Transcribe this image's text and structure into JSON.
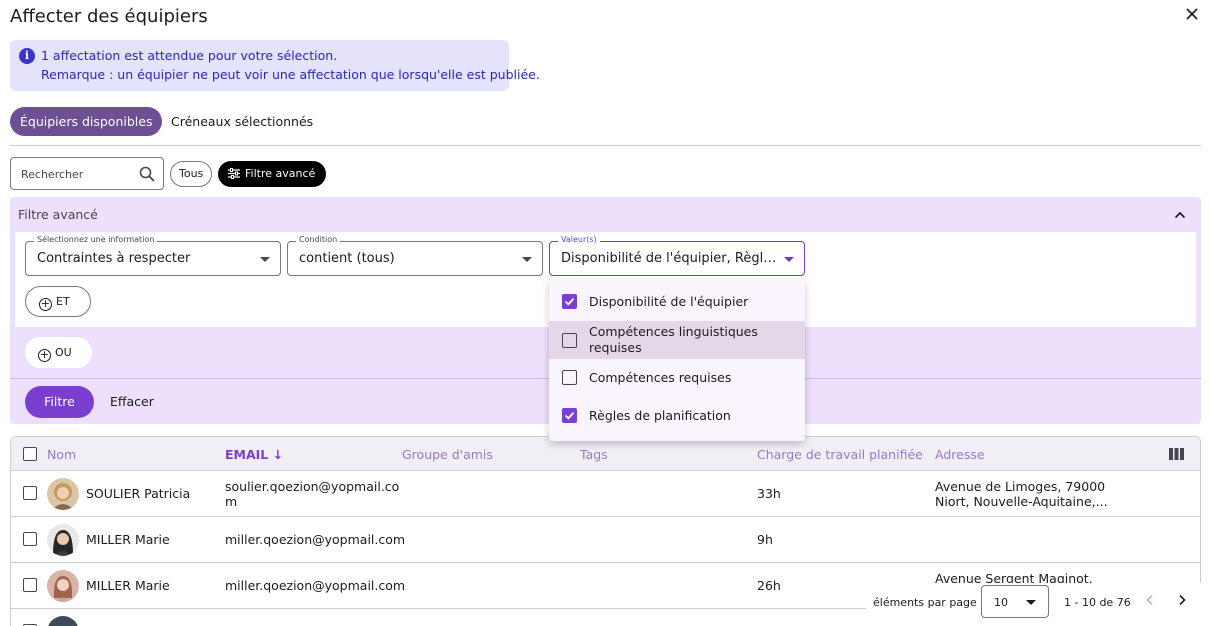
{
  "dialog": {
    "title": "Affecter des équipiers"
  },
  "banner": {
    "line1": "1 affectation est attendue pour votre sélection.",
    "line2": "Remarque : un équipier ne peut voir une affectation que lorsqu'elle est publiée."
  },
  "tabs": [
    {
      "label": "Équipiers disponibles",
      "active": true
    },
    {
      "label": "Créneaux sélectionnés",
      "active": false
    }
  ],
  "search": {
    "placeholder": "Rechercher"
  },
  "chips": {
    "all": "Tous",
    "advanced": "Filtre avancé"
  },
  "advanced_filter": {
    "title": "Filtre avancé",
    "field1": {
      "label": "Sélectionnez une information",
      "value": "Contraintes à respecter"
    },
    "field2": {
      "label": "Condition",
      "value": "contient (tous)"
    },
    "field3": {
      "label": "Valeur(s)",
      "value": "Disponibilité de l'équipier, Règles de ..."
    },
    "and_label": "ET",
    "or_label": "OU",
    "apply_label": "Filtre",
    "clear_label": "Effacer"
  },
  "values_dropdown": [
    {
      "label": "Disponibilité de l'équipier",
      "checked": true
    },
    {
      "label": "Compétences linguistiques requises",
      "checked": false
    },
    {
      "label": "Compétences requises",
      "checked": false
    },
    {
      "label": "Règles de planification",
      "checked": true
    }
  ],
  "table": {
    "columns": [
      "Nom",
      "EMAIL",
      "Groupe d'amis",
      "Tags",
      "Charge de travail planifiée",
      "Adresse"
    ],
    "sort_arrow": "↓",
    "rows": [
      {
        "name": "SOULIER Patricia",
        "email1": "soulier.qoezion@yopmail.co",
        "email2": "m",
        "workload": "33h",
        "address1": "Avenue de Limoges, 79000",
        "address2": "Niort, Nouvelle-Aquitaine,..."
      },
      {
        "name": "MILLER Marie",
        "email1": "miller.qoezion@yopmail.com",
        "email2": "",
        "workload": "9h",
        "address1": "",
        "address2": ""
      },
      {
        "name": "MILLER Marie",
        "email1": "miller.qoezion@yopmail.com",
        "email2": "",
        "workload": "26h",
        "address1": "Avenue Sergent Maginot,",
        "address2": ""
      }
    ]
  },
  "pagination": {
    "per_page_label": "éléments par page",
    "per_page": "10",
    "range": "1 - 10 de 76"
  },
  "colors": {
    "accent": "#7b3fd0",
    "tab_active": "#6d4f93",
    "panel_bg": "#ece0fc",
    "banner_bg": "#e5e3fb"
  }
}
